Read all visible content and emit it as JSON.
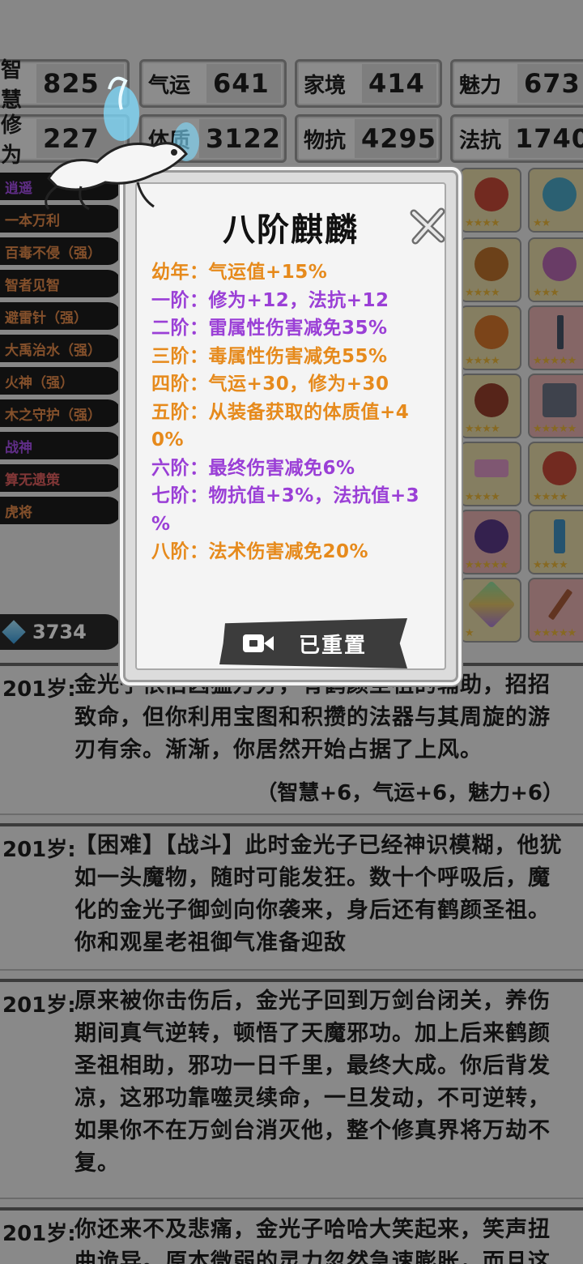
{
  "stats": [
    {
      "label": "智慧",
      "value": "825"
    },
    {
      "label": "气运",
      "value": "641"
    },
    {
      "label": "家境",
      "value": "414"
    },
    {
      "label": "魅力",
      "value": "673"
    },
    {
      "label": "修为",
      "value": "227"
    },
    {
      "label": "体质",
      "value": "3122"
    },
    {
      "label": "物抗",
      "value": "4295"
    },
    {
      "label": "法抗",
      "value": "1740"
    }
  ],
  "talents": [
    {
      "label": "逍遥",
      "tone": "purple"
    },
    {
      "label": "一本万利",
      "tone": "orange"
    },
    {
      "label": "百毒不侵（强）",
      "tone": "orange"
    },
    {
      "label": "智者见智",
      "tone": "orange"
    },
    {
      "label": "避雷针（强）",
      "tone": "orange"
    },
    {
      "label": "大禹治水（强）",
      "tone": "orange"
    },
    {
      "label": "火神（强）",
      "tone": "orange"
    },
    {
      "label": "木之守护（强）",
      "tone": "orange"
    },
    {
      "label": "战神",
      "tone": "purple"
    },
    {
      "label": "算无遗策",
      "tone": "red"
    },
    {
      "label": "虎将",
      "tone": "orange"
    }
  ],
  "gems": {
    "count": "3734",
    "icon": "gem-icon"
  },
  "equipment": [
    {
      "name": "boots-icon",
      "bg": "gold",
      "stars": "★★★★"
    },
    {
      "name": "orb-icon",
      "bg": "gold",
      "stars": "★★"
    },
    {
      "name": "censer-icon",
      "bg": "gold",
      "stars": "★★★★"
    },
    {
      "name": "teapot-icon",
      "bg": "gold",
      "stars": "★★★"
    },
    {
      "name": "ring-icon",
      "bg": "gold",
      "stars": "★★★★"
    },
    {
      "name": "spear-icon",
      "bg": "red",
      "stars": "★★★★★"
    },
    {
      "name": "gem-ring-icon",
      "bg": "gold",
      "stars": "★★★★"
    },
    {
      "name": "axe-icon",
      "bg": "red",
      "stars": "★★★★★"
    },
    {
      "name": "scroll-icon",
      "bg": "gold",
      "stars": "★★★★"
    },
    {
      "name": "fan-icon",
      "bg": "gold",
      "stars": "★★★★"
    },
    {
      "name": "mirror-icon",
      "bg": "red",
      "stars": "★★★★★"
    },
    {
      "name": "sword-icon",
      "bg": "gold",
      "stars": "★★★★"
    },
    {
      "name": "crystal-icon",
      "bg": "gold",
      "stars": "★"
    },
    {
      "name": "staff-icon",
      "bg": "red",
      "stars": "★★★★★"
    }
  ],
  "log": [
    {
      "age": "201岁:",
      "text": "金光子依旧凶猛万分，有鹤颜圣祖的辅助，招招致命，但你利用宝图和积攒的法器与其周旋的游刃有余。渐渐，你居然开始占据了上风。",
      "bonus": "（智慧+6，气运+6，魅力+6）"
    },
    {
      "age": "201岁:",
      "text": "【困难】【战斗】此时金光子已经神识模糊，他犹如一头魔物，随时可能发狂。数十个呼吸后，魔化的金光子御剑向你袭来，身后还有鹤颜圣祖。你和观星老祖御气准备迎敌",
      "bonus": ""
    },
    {
      "age": "201岁:",
      "text": "原来被你击伤后，金光子回到万剑台闭关，养伤期间真气逆转，顿悟了天魔邪功。加上后来鹤颜圣祖相助，邪功一日千里，最终大成。你后背发凉，这邪功靠噬灵续命，一旦发动，不可逆转，如果你不在万剑台消灭他，整个修真界将万劫不复。",
      "bonus": ""
    },
    {
      "age": "201岁:",
      "text": "你还来不及悲痛，金光子哈哈大笑起来，笑声扭曲诡异。原本微弱的灵力忽然急速膨胀，而且这",
      "bonus": ""
    }
  ],
  "modal": {
    "title": "八阶麒麟",
    "lines": [
      {
        "text": "幼年：气运值+15%",
        "tone": "orange"
      },
      {
        "text": "一阶：修为+12，法抗+12",
        "tone": "purple"
      },
      {
        "text": "二阶：雷属性伤害减免35%",
        "tone": "purple"
      },
      {
        "text": "三阶：毒属性伤害减免55%",
        "tone": "orange"
      },
      {
        "text": "四阶：气运+30，修为+30",
        "tone": "orange"
      },
      {
        "text": "五阶：从装备获取的体质值+4",
        "tone": "orange"
      },
      {
        "text": "0%",
        "tone": "orange"
      },
      {
        "text": "六阶：最终伤害减免6%",
        "tone": "purple"
      },
      {
        "text": "七阶：物抗值+3%，法抗值+3",
        "tone": "purple"
      },
      {
        "text": "%",
        "tone": "purple"
      },
      {
        "text": "八阶：法术伤害减免20%",
        "tone": "orange"
      }
    ],
    "reset_label": "已重置",
    "close_icon": "close-icon",
    "video_icon": "video-camera-icon"
  },
  "colors": {
    "orange": "#e68a1c",
    "purple": "#9a3fd6",
    "dim_overlay": "rgba(0,0,0,0.42)"
  }
}
